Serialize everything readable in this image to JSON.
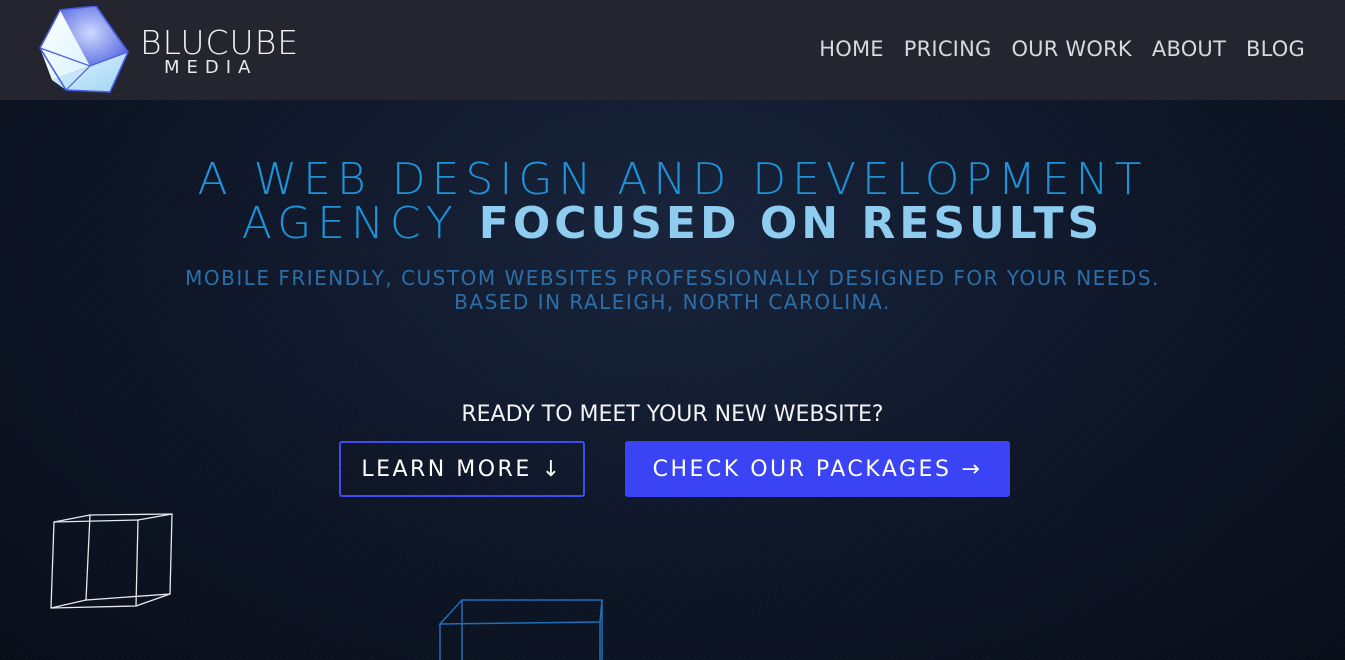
{
  "brand": {
    "name": "BLUCUBE",
    "subtitle": "MEDIA"
  },
  "nav": {
    "items": [
      "HOME",
      "PRICING",
      "OUR WORK",
      "ABOUT",
      "BLOG"
    ]
  },
  "hero": {
    "headline_line1": "A WEB DESIGN AND DEVELOPMENT",
    "headline_line2_light": "AGENCY",
    "headline_line2_bold": "FOCUSED ON RESULTS",
    "subhead_line1": "MOBILE FRIENDLY, CUSTOM WEBSITES PROFESSIONALLY DESIGNED FOR YOUR NEEDS.",
    "subhead_line2": "BASED IN RALEIGH, NORTH CAROLINA.",
    "cta_prompt": "READY TO MEET YOUR NEW WEBSITE?",
    "learn_more_label": "LEARN MORE",
    "learn_more_icon": "arrow-down-icon",
    "packages_label": "CHECK OUR PACKAGES",
    "packages_icon": "arrow-right-icon"
  },
  "colors": {
    "topbar": "#25252f",
    "accent_blue": "#1d93d8",
    "button_blue": "#3a44f5"
  }
}
